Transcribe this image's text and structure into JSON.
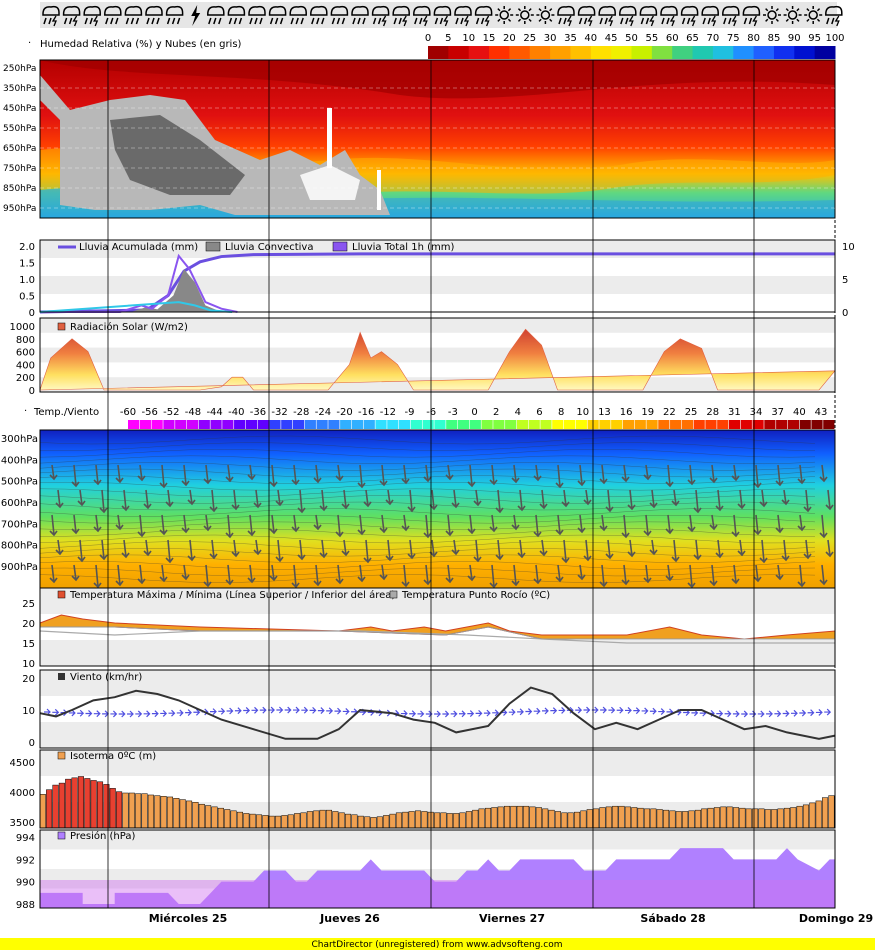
{
  "colors": {
    "rh_scale": [
      "#a00000",
      "#c80000",
      "#e61010",
      "#ff3000",
      "#ff5a00",
      "#ff8000",
      "#ffa000",
      "#ffc000",
      "#ffe000",
      "#f0f000",
      "#c8f000",
      "#80e040",
      "#40d080",
      "#20c8b0",
      "#20c0e0",
      "#2090ff",
      "#2060ff",
      "#1030f0",
      "#0010d0",
      "#0000a0"
    ],
    "temp_scale": [
      "#ff00ff",
      "#d000ff",
      "#9000ff",
      "#6000ff",
      "#3040ff",
      "#3080ff",
      "#30b0ff",
      "#30e0ff",
      "#30ffd0",
      "#40ff80",
      "#80ff40",
      "#c0ff20",
      "#ffff00",
      "#ffd000",
      "#ffa000",
      "#ff7000",
      "#ff4000",
      "#e00000",
      "#b00000",
      "#800000"
    ],
    "rain_line": "#6a4fe0",
    "convective": "#888888",
    "rain_total": "#8a55f0",
    "pressure_fill": "#b080ff",
    "isotherm_bar": "#f0a050",
    "wind_line": "#333333",
    "wind_arrows": "#5050e0",
    "footer_bg": "#ffff00"
  },
  "icons": [
    "storm-icon",
    "storm-icon",
    "storm-icon",
    "cloud-rain-icon",
    "cloud-rain-icon",
    "cloud-rain-icon",
    "cloud-rain-icon",
    "lightning-icon",
    "cloud-rain-icon",
    "cloud-rain-icon",
    "cloud-rain-icon",
    "cloud-rain-icon",
    "cloud-rain-icon",
    "cloud-rain-icon",
    "cloud-rain-icon",
    "cloud-rain-icon",
    "storm-icon",
    "storm-icon",
    "storm-icon",
    "storm-icon",
    "storm-icon",
    "storm-icon",
    "sun-icon",
    "sun-icon",
    "sun-icon",
    "storm-icon",
    "storm-icon",
    "storm-icon",
    "storm-icon",
    "storm-icon",
    "storm-icon",
    "storm-icon",
    "storm-icon",
    "storm-icon",
    "storm-icon",
    "sun-icon",
    "sun-icon",
    "sun-icon",
    "storm-icon"
  ],
  "chart_data": [
    {
      "type": "heatmap",
      "title": "Humedad Relativa (%) y Nubes (en gris)",
      "y_labels": [
        "250hPa",
        "350hPa",
        "450hPa",
        "550hPa",
        "650hPa",
        "750hPa",
        "850hPa",
        "950hPa"
      ],
      "legend_values": [
        "0",
        "5",
        "10",
        "15",
        "20",
        "25",
        "30",
        "35",
        "40",
        "45",
        "50",
        "55",
        "60",
        "65",
        "70",
        "75",
        "80",
        "85",
        "90",
        "95",
        "100"
      ]
    },
    {
      "type": "line",
      "legend": [
        "Lluvia Acumulada (mm)",
        "Lluvia Convectiva",
        "Lluvia Total 1h (mm)"
      ],
      "y_left_ticks": [
        "2.0",
        "1.5",
        "1.0",
        "0.5",
        "0"
      ],
      "y_right_ticks": [
        "10",
        "5",
        "0"
      ],
      "ylim": [
        0,
        2.0
      ],
      "y2lim": [
        0,
        10
      ],
      "total_1h": [
        [
          0,
          0
        ],
        [
          15,
          0
        ],
        [
          19,
          0.2
        ],
        [
          21,
          0.1
        ],
        [
          24,
          0.5
        ],
        [
          26,
          1.7
        ],
        [
          28,
          1.3
        ],
        [
          31,
          0.3
        ],
        [
          34,
          0.1
        ],
        [
          37,
          0
        ]
      ],
      "convective": [
        [
          0,
          0
        ],
        [
          17,
          0
        ],
        [
          20,
          0.15
        ],
        [
          22,
          0.08
        ],
        [
          25,
          0.5
        ],
        [
          27,
          1.3
        ],
        [
          29,
          0.9
        ],
        [
          31,
          0.2
        ],
        [
          34,
          0
        ]
      ],
      "accumulated": [
        [
          0,
          0
        ],
        [
          20,
          0.3
        ],
        [
          24,
          2.5
        ],
        [
          27,
          6.2
        ],
        [
          30,
          7.6
        ],
        [
          34,
          8.4
        ],
        [
          40,
          8.7
        ],
        [
          60,
          8.8
        ],
        [
          149,
          8.8
        ]
      ]
    },
    {
      "type": "area",
      "title": "Radiación Solar (W/m2)",
      "y_ticks": [
        "1000",
        "800",
        "600",
        "400",
        "200",
        "0"
      ],
      "ylim": [
        0,
        1000
      ],
      "values": [
        [
          0,
          0
        ],
        [
          2,
          500
        ],
        [
          6,
          800
        ],
        [
          9,
          600
        ],
        [
          12,
          0
        ],
        [
          30,
          0
        ],
        [
          34,
          50
        ],
        [
          36,
          200
        ],
        [
          38,
          200
        ],
        [
          40,
          0
        ],
        [
          54,
          0
        ],
        [
          58,
          400
        ],
        [
          60,
          900
        ],
        [
          62,
          500
        ],
        [
          64,
          600
        ],
        [
          67,
          400
        ],
        [
          70,
          0
        ],
        [
          84,
          0
        ],
        [
          88,
          600
        ],
        [
          91,
          950
        ],
        [
          94,
          700
        ],
        [
          97,
          0
        ],
        [
          113,
          0
        ],
        [
          117,
          600
        ],
        [
          120,
          800
        ],
        [
          124,
          650
        ],
        [
          127,
          0
        ],
        [
          146,
          0
        ],
        [
          149,
          300
        ]
      ]
    },
    {
      "type": "heatmap",
      "title": "Temp./Viento",
      "legend_values": [
        "-60",
        "-56",
        "-52",
        "-48",
        "-44",
        "-40",
        "-36",
        "-32",
        "-28",
        "-24",
        "-20",
        "-16",
        "-12",
        "-9",
        "-6",
        "-3",
        "0",
        "2",
        "4",
        "6",
        "8",
        "10",
        "13",
        "16",
        "19",
        "22",
        "25",
        "28",
        "31",
        "34",
        "37",
        "40",
        "43"
      ],
      "y_labels": [
        "300hPa",
        "400hPa",
        "500hPa",
        "600hPa",
        "700hPa",
        "800hPa",
        "900hPa"
      ]
    },
    {
      "type": "line",
      "legend": [
        "Temperatura Máxima / Mínima (Línea Superior / Inferior del área)",
        "Temperatura Punto Rocío (ºC)"
      ],
      "y_ticks": [
        "25",
        "20",
        "15",
        "10"
      ],
      "ylim": [
        10,
        25
      ],
      "max": [
        [
          0,
          20
        ],
        [
          4,
          22
        ],
        [
          8,
          21
        ],
        [
          14,
          20
        ],
        [
          30,
          19
        ],
        [
          56,
          18
        ],
        [
          62,
          19
        ],
        [
          66,
          18
        ],
        [
          72,
          19
        ],
        [
          76,
          18
        ],
        [
          84,
          20
        ],
        [
          88,
          18
        ],
        [
          94,
          17
        ],
        [
          110,
          17
        ],
        [
          118,
          19
        ],
        [
          124,
          17
        ],
        [
          132,
          16
        ],
        [
          140,
          17
        ],
        [
          149,
          18
        ]
      ],
      "min": [
        [
          0,
          19
        ],
        [
          14,
          19
        ],
        [
          30,
          18
        ],
        [
          56,
          18
        ],
        [
          76,
          17
        ],
        [
          84,
          19
        ],
        [
          94,
          16
        ],
        [
          149,
          16
        ]
      ],
      "dew": [
        [
          0,
          18
        ],
        [
          14,
          17
        ],
        [
          30,
          18
        ],
        [
          60,
          18
        ],
        [
          80,
          17
        ],
        [
          94,
          16
        ],
        [
          110,
          15
        ],
        [
          130,
          15
        ],
        [
          149,
          15
        ]
      ]
    },
    {
      "type": "line",
      "title": "Viento (km/hr)",
      "y_ticks": [
        "20",
        "10",
        "0"
      ],
      "ylim": [
        0,
        20
      ],
      "values": [
        [
          0,
          9
        ],
        [
          3,
          8
        ],
        [
          6,
          10
        ],
        [
          10,
          13
        ],
        [
          14,
          14
        ],
        [
          18,
          16
        ],
        [
          22,
          15
        ],
        [
          26,
          13
        ],
        [
          30,
          10
        ],
        [
          34,
          7
        ],
        [
          40,
          4
        ],
        [
          46,
          1
        ],
        [
          52,
          1
        ],
        [
          56,
          4
        ],
        [
          60,
          10
        ],
        [
          66,
          9
        ],
        [
          70,
          7
        ],
        [
          74,
          6
        ],
        [
          78,
          3
        ],
        [
          84,
          5
        ],
        [
          88,
          12
        ],
        [
          92,
          17
        ],
        [
          96,
          15
        ],
        [
          100,
          9
        ],
        [
          104,
          4
        ],
        [
          108,
          6
        ],
        [
          112,
          4
        ],
        [
          116,
          7
        ],
        [
          120,
          10
        ],
        [
          124,
          10
        ],
        [
          128,
          7
        ],
        [
          132,
          4
        ],
        [
          136,
          5
        ],
        [
          140,
          3
        ],
        [
          146,
          1
        ],
        [
          149,
          2
        ]
      ]
    },
    {
      "type": "bar",
      "title": "Isoterma 0ºC (m)",
      "y_ticks": [
        "4500",
        "4000",
        "3500"
      ],
      "ylim": [
        3500,
        4600
      ],
      "values": [
        3980,
        4050,
        4120,
        4150,
        4210,
        4230,
        4250,
        4220,
        4190,
        4170,
        4130,
        4070,
        4020,
        4000,
        4000,
        3990,
        3990,
        3970,
        3960,
        3950,
        3940,
        3920,
        3900,
        3880,
        3860,
        3830,
        3810,
        3790,
        3770,
        3750,
        3730,
        3710,
        3690,
        3680,
        3670,
        3660,
        3650,
        3650,
        3660,
        3670,
        3690,
        3700,
        3720,
        3730,
        3740,
        3740,
        3720,
        3700,
        3680,
        3670,
        3650,
        3640,
        3630,
        3640,
        3660,
        3680,
        3700,
        3710,
        3720,
        3730,
        3720,
        3710,
        3700,
        3700,
        3690,
        3690,
        3700,
        3720,
        3740,
        3760,
        3770,
        3780,
        3790,
        3800,
        3800,
        3800,
        3800,
        3790,
        3780,
        3760,
        3740,
        3720,
        3700,
        3700,
        3710,
        3730,
        3750,
        3760,
        3780,
        3790,
        3800,
        3800,
        3790,
        3780,
        3770,
        3760,
        3760,
        3750,
        3740,
        3730,
        3720,
        3720,
        3730,
        3740,
        3760,
        3770,
        3780,
        3790,
        3790,
        3780,
        3770,
        3760,
        3760,
        3760,
        3750,
        3750,
        3760,
        3770,
        3780,
        3800,
        3820,
        3850,
        3880,
        3930,
        3960
      ],
      "red_from": 1,
      "red_to": 12
    },
    {
      "type": "area",
      "title": "Presión (hPa)",
      "y_ticks": [
        "994",
        "992",
        "990",
        "988"
      ],
      "ylim": [
        987,
        995
      ],
      "values": [
        [
          0,
          989
        ],
        [
          8,
          989
        ],
        [
          8,
          988
        ],
        [
          14,
          988
        ],
        [
          14,
          989
        ],
        [
          24,
          989
        ],
        [
          26,
          988
        ],
        [
          30,
          988
        ],
        [
          32,
          989
        ],
        [
          34,
          990
        ],
        [
          40,
          990
        ],
        [
          42,
          991
        ],
        [
          46,
          991
        ],
        [
          48,
          990
        ],
        [
          50,
          990
        ],
        [
          52,
          991
        ],
        [
          60,
          991
        ],
        [
          62,
          992
        ],
        [
          64,
          991
        ],
        [
          72,
          991
        ],
        [
          74,
          990
        ],
        [
          78,
          990
        ],
        [
          80,
          991
        ],
        [
          82,
          991
        ],
        [
          84,
          992
        ],
        [
          86,
          991
        ],
        [
          88,
          991
        ],
        [
          90,
          992
        ],
        [
          100,
          992
        ],
        [
          102,
          991
        ],
        [
          106,
          991
        ],
        [
          108,
          992
        ],
        [
          118,
          992
        ],
        [
          120,
          993
        ],
        [
          128,
          993
        ],
        [
          130,
          992
        ],
        [
          138,
          992
        ],
        [
          140,
          993
        ],
        [
          142,
          992
        ],
        [
          146,
          991
        ],
        [
          148,
          992
        ],
        [
          149,
          992
        ]
      ]
    },
    {
      "type": "table",
      "x_labels": [
        "Miércoles 25",
        "Jueves 26",
        "Viernes 27",
        "Sábado 28",
        "Domingo 29"
      ]
    }
  ],
  "footer": "ChartDirector (unregistered) from www.advsofteng.com"
}
